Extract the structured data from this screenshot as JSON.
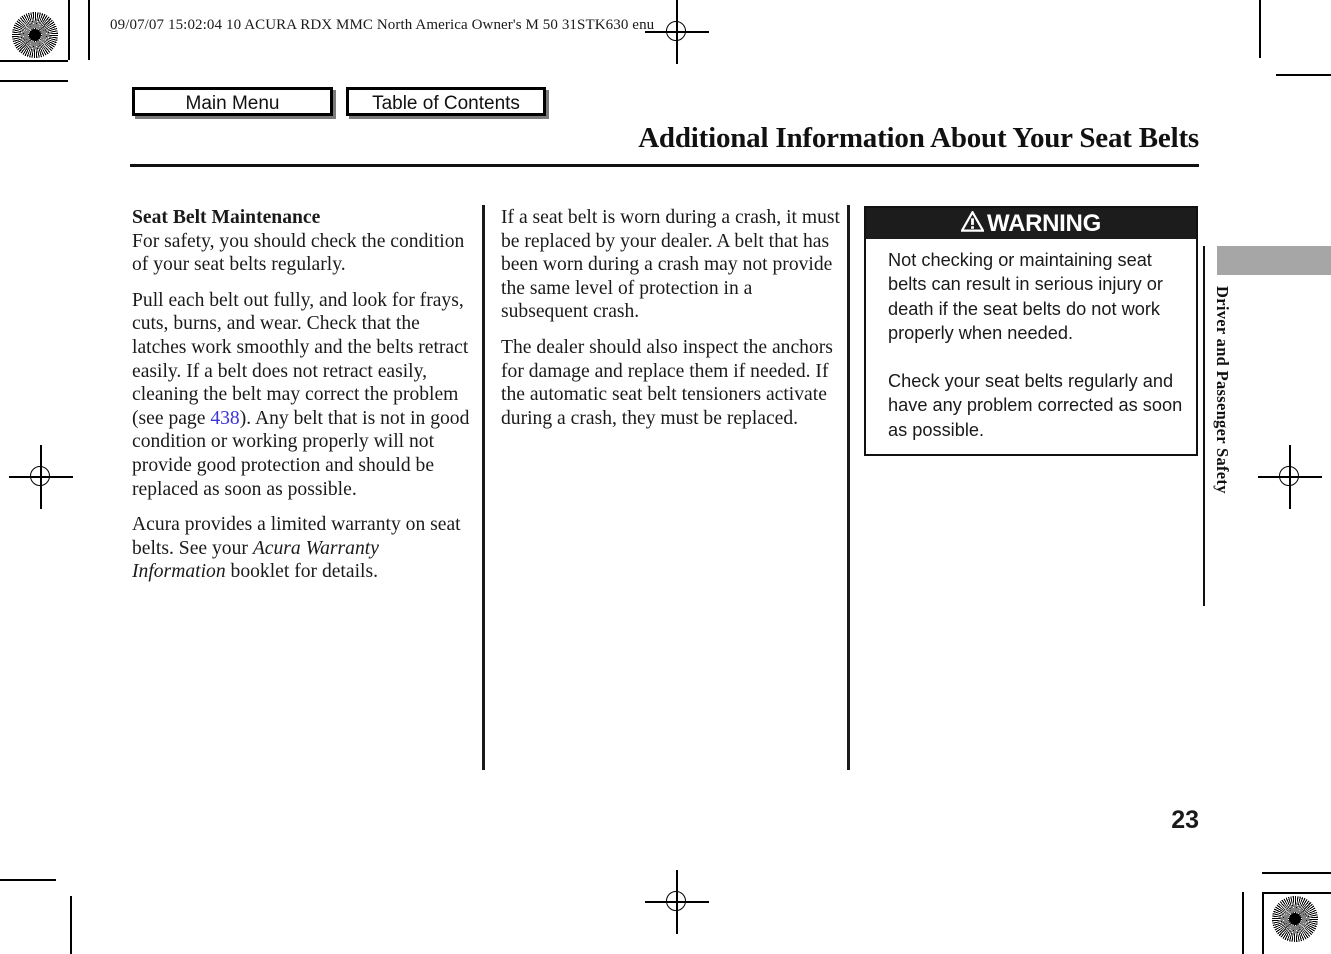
{
  "doc_header": "09/07/07 15:02:04    10 ACURA RDX MMC North America Owner's M 50 31STK630 enu",
  "nav": {
    "main_menu": "Main Menu",
    "table_of_contents": "Table of Contents"
  },
  "title": "Additional Information About Your Seat Belts",
  "columns": {
    "col1": {
      "heading": "Seat Belt Maintenance",
      "p1_after_heading": "For safety, you should check the condition of your seat belts regularly.",
      "p2_before_link": "Pull each belt out fully, and look for frays, cuts, burns, and wear. Check that the latches work smoothly and the belts retract easily. If a belt does not retract easily, cleaning the belt may correct the problem (see page ",
      "p2_link": "438",
      "p2_after_link": "). Any belt that is not in good condition or working properly will not provide good protection and should be replaced as soon as possible.",
      "p3_part1": "Acura provides a limited warranty on seat belts. See your ",
      "p3_italic": "Acura Warranty Information",
      "p3_part2": " booklet for details."
    },
    "col2": {
      "p1": "If a seat belt is worn during a crash, it must be replaced by your dealer. A belt that has been worn during a crash may not provide the same level of protection in a subsequent crash.",
      "p2": "The dealer should also inspect the anchors for damage and replace them if needed. If the automatic seat belt tensioners activate during a crash, they must be replaced."
    }
  },
  "warning": {
    "label": "WARNING",
    "icon": "warning-triangle-icon",
    "p1": "Not checking or maintaining seat belts can result in serious injury or death if the seat belts do not work properly when needed.",
    "p2": "Check your seat belts regularly and have any problem corrected as soon as possible.",
    "bar_color": "#1c1c1c",
    "bar_text_color": "#ffffff"
  },
  "side_tab": {
    "label": "Driver and Passenger Safety",
    "tab_color": "#a6a6a6"
  },
  "page_number": "23",
  "link_color": "#3a35d6",
  "print_marks": {
    "star_icon": "registration-starburst-icon",
    "cross_icon": "registration-crosshair-icon"
  }
}
